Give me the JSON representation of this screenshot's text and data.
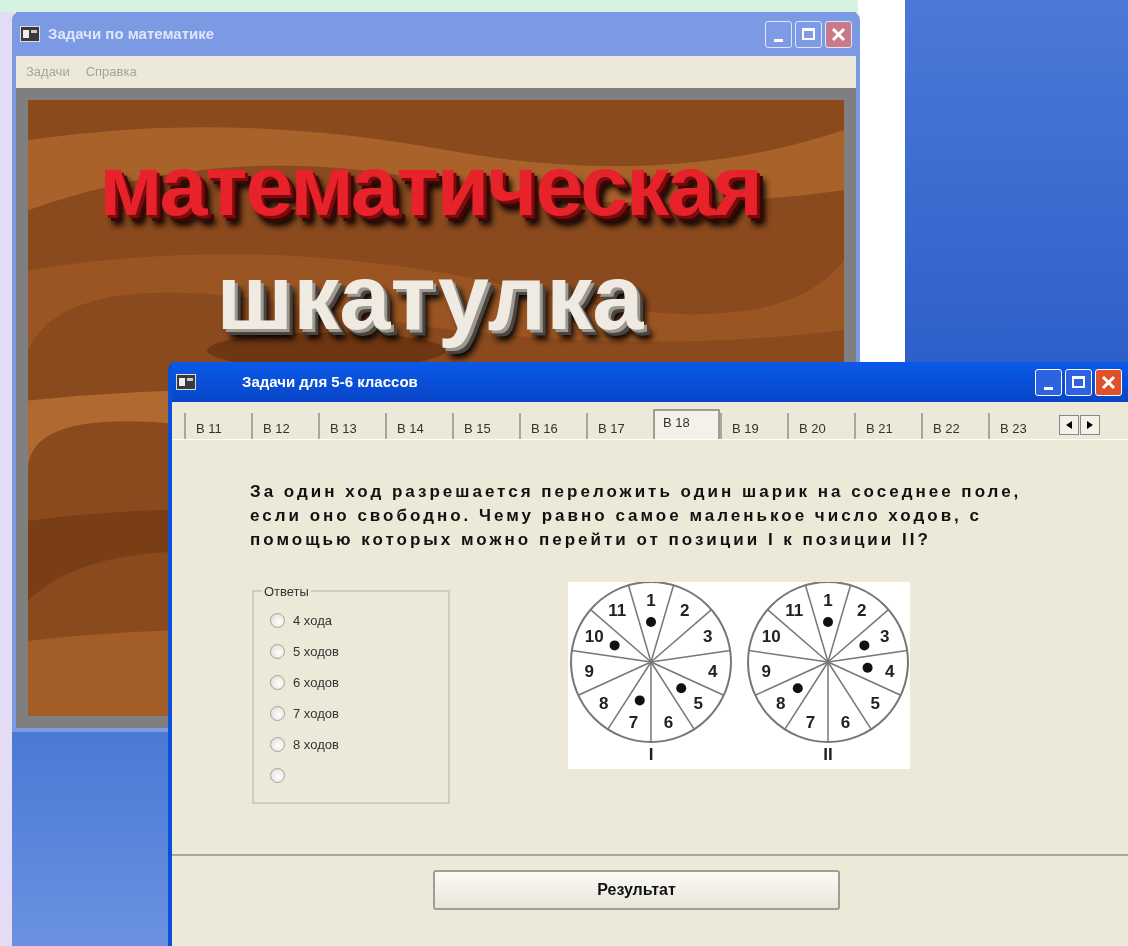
{
  "back_window": {
    "title": "Задачи по математике",
    "active": false,
    "menu": [
      "Задачи",
      "Справка"
    ],
    "splash": {
      "line_1": "математическая",
      "line_2": "шкатулка"
    }
  },
  "front_window": {
    "title": "Задачи для  5-6 классов",
    "active": true,
    "tabs": [
      {
        "label": "В 11",
        "selected": false
      },
      {
        "label": "В 12",
        "selected": false
      },
      {
        "label": "В 13",
        "selected": false
      },
      {
        "label": "В 14",
        "selected": false
      },
      {
        "label": "В 15",
        "selected": false
      },
      {
        "label": "В 16",
        "selected": false
      },
      {
        "label": "В 17",
        "selected": false
      },
      {
        "label": "В 18",
        "selected": true
      },
      {
        "label": "В 19",
        "selected": false
      },
      {
        "label": "В 20",
        "selected": false
      },
      {
        "label": "В 21",
        "selected": false
      },
      {
        "label": "В 22",
        "selected": false
      },
      {
        "label": "В 23",
        "selected": false
      }
    ],
    "question": "За один ход разрешается переложить один шарик на соседнее поле, если оно свободно. Чему равно самое маленькое число ходов, с помощью которых можно перейти от позиции I  к  позиции II?",
    "answers": {
      "legend": "Ответы",
      "options": [
        {
          "label": "4 хода",
          "selected": false
        },
        {
          "label": "5 ходов",
          "selected": false
        },
        {
          "label": "6 ходов",
          "selected": false
        },
        {
          "label": "7 ходов",
          "selected": false
        },
        {
          "label": "8 ходов",
          "selected": false
        },
        {
          "selected": false
        }
      ]
    },
    "wheels": [
      {
        "caption": "I",
        "sectors": [
          {
            "number": "1",
            "ball": true
          },
          {
            "number": "2",
            "ball": false
          },
          {
            "number": "3",
            "ball": false
          },
          {
            "number": "4",
            "ball": false
          },
          {
            "number": "5",
            "ball": true
          },
          {
            "number": "6",
            "ball": false
          },
          {
            "number": "7",
            "ball": true
          },
          {
            "number": "8",
            "ball": false
          },
          {
            "number": "9",
            "ball": false
          },
          {
            "number": "10",
            "ball": true
          },
          {
            "number": "11",
            "ball": false
          }
        ]
      },
      {
        "caption": "II",
        "sectors": [
          {
            "number": "1",
            "ball": true
          },
          {
            "number": "2",
            "ball": false
          },
          {
            "number": "3",
            "ball": true
          },
          {
            "number": "4",
            "ball": true
          },
          {
            "number": "5",
            "ball": false
          },
          {
            "number": "6",
            "ball": false
          },
          {
            "number": "7",
            "ball": false
          },
          {
            "number": "8",
            "ball": true
          },
          {
            "number": "9",
            "ball": false
          },
          {
            "number": "10",
            "ball": false
          },
          {
            "number": "11",
            "ball": false
          }
        ]
      }
    ],
    "result_button": "Результат"
  }
}
